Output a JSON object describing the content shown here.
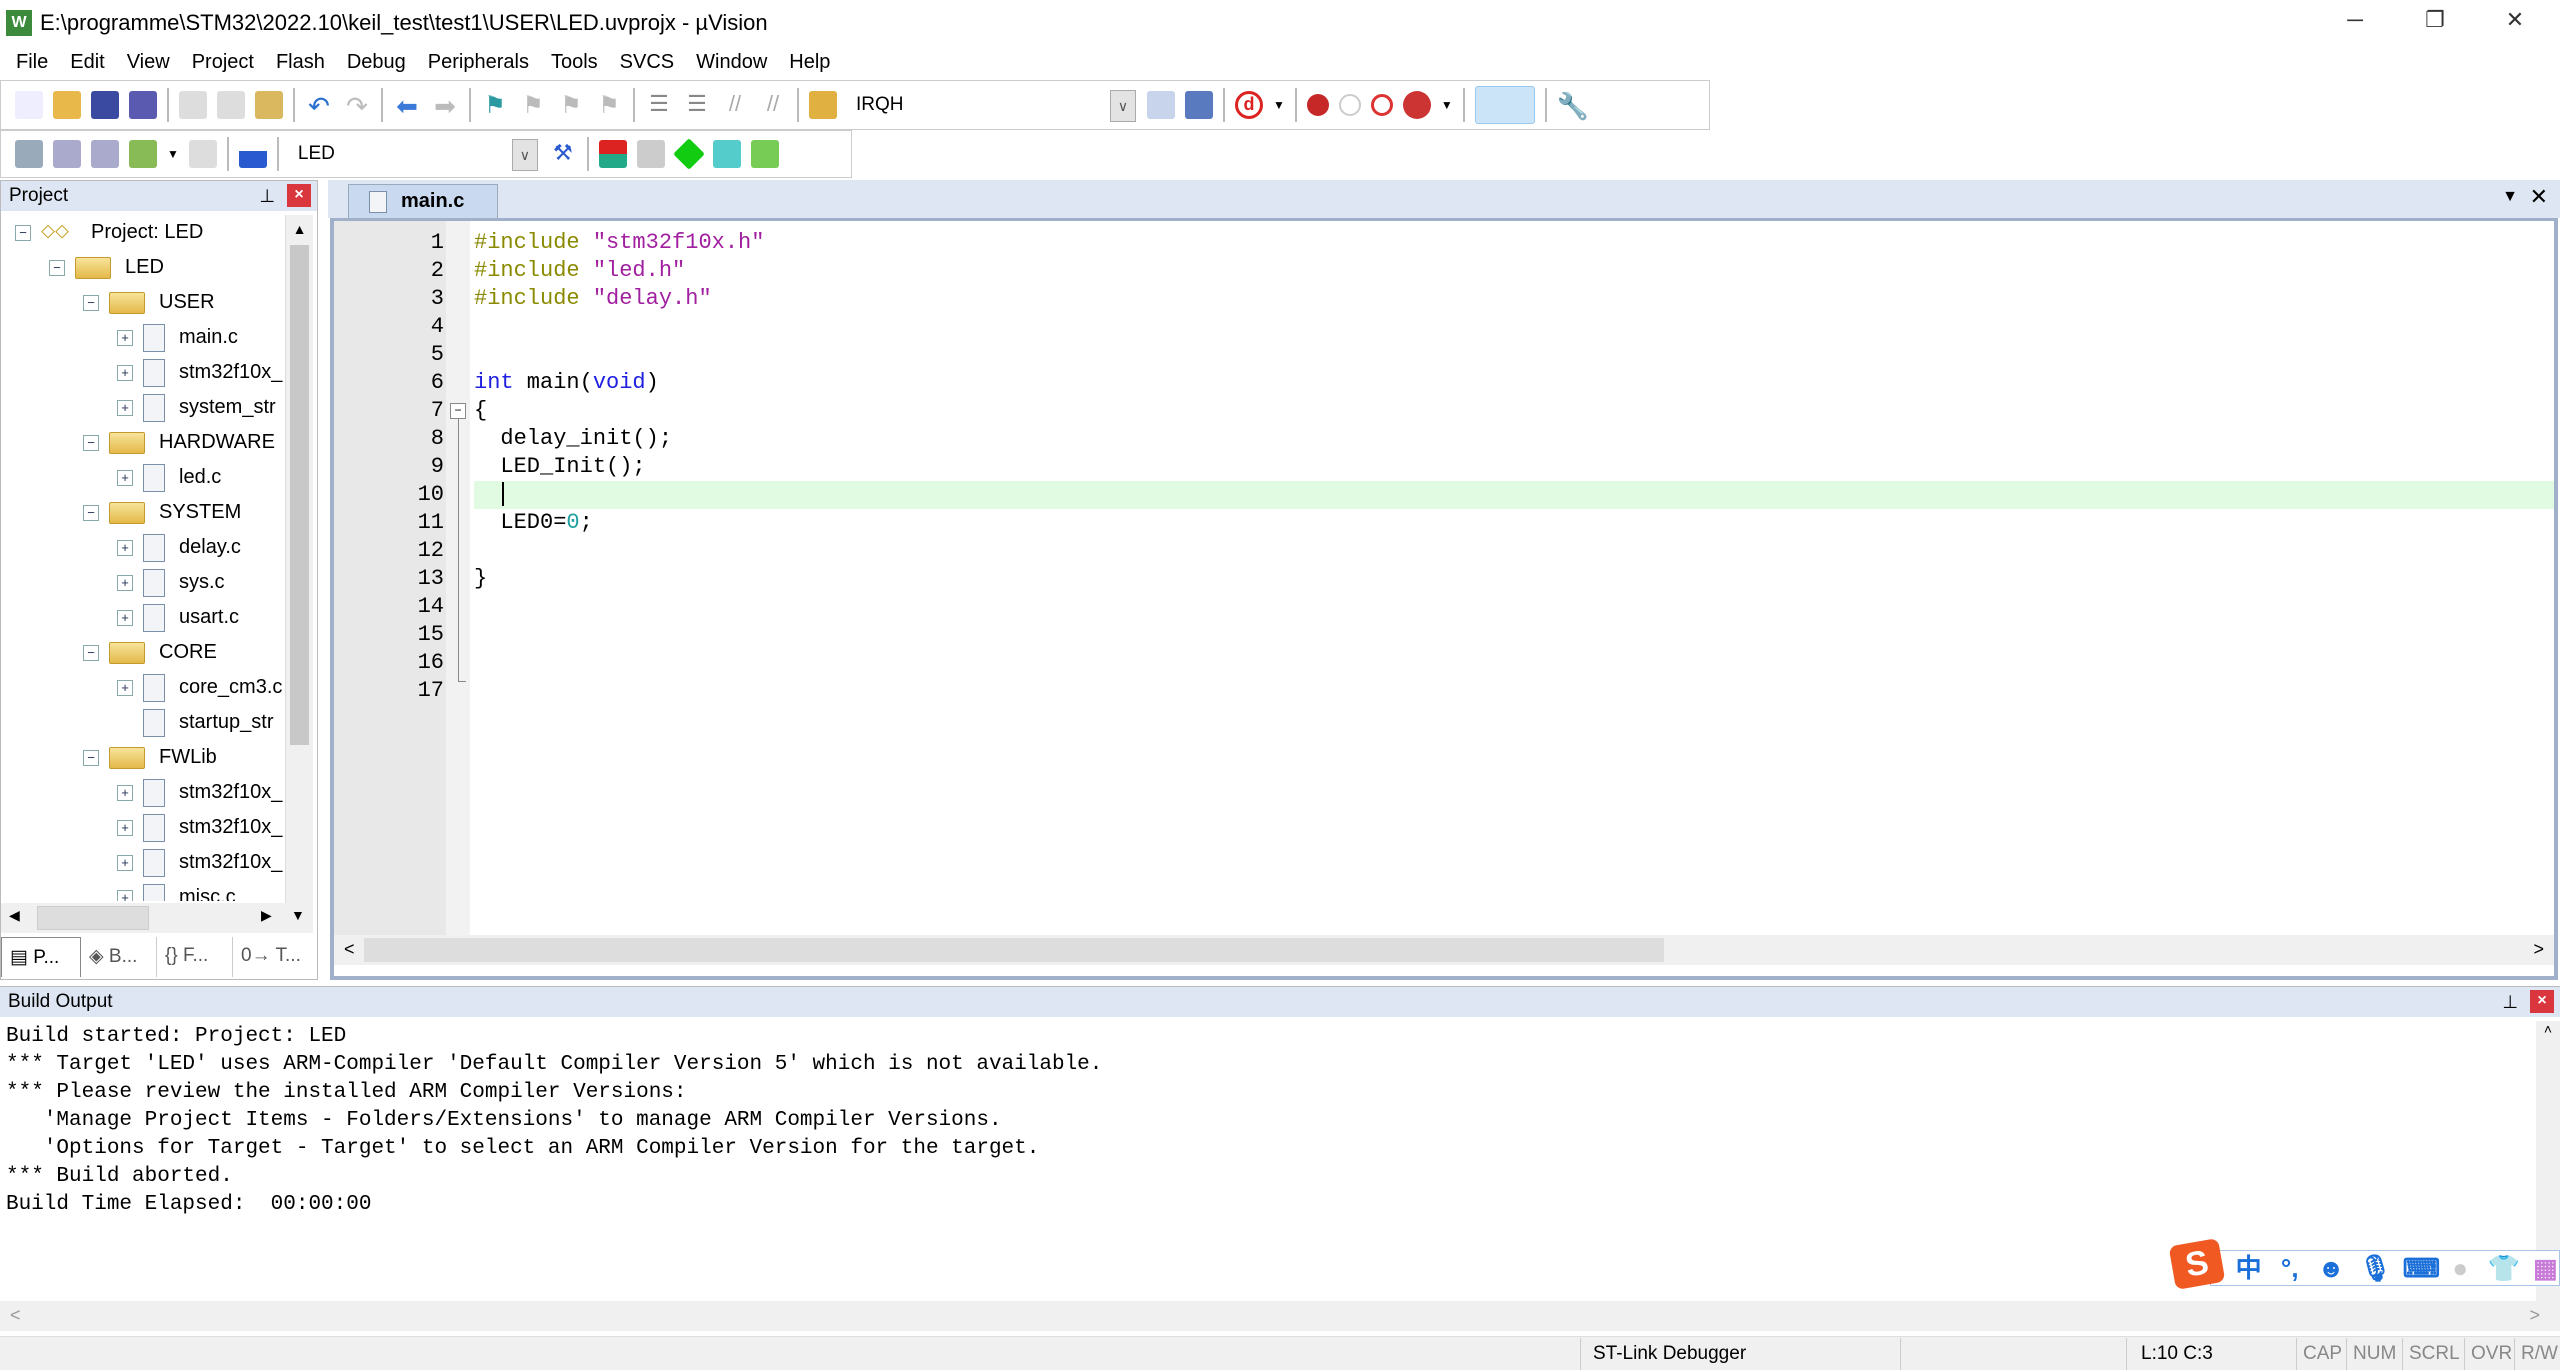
{
  "window": {
    "title": "E:\\programme\\STM32\\2022.10\\keil_test\\test1\\USER\\LED.uvprojx - µVision",
    "minimize": "─",
    "restore": "❐",
    "close": "✕"
  },
  "menu": [
    "File",
    "Edit",
    "View",
    "Project",
    "Flash",
    "Debug",
    "Peripherals",
    "Tools",
    "SVCS",
    "Window",
    "Help"
  ],
  "toolbar1": {
    "find_combo": "IRQH"
  },
  "toolbar2": {
    "target_combo": "LED"
  },
  "project_panel": {
    "title": "Project",
    "tree": [
      {
        "label": "Project: LED",
        "level": 0,
        "kind": "project",
        "exp": "−"
      },
      {
        "label": "LED",
        "level": 1,
        "kind": "target",
        "exp": "−"
      },
      {
        "label": "USER",
        "level": 2,
        "kind": "folder",
        "exp": "−"
      },
      {
        "label": "main.c",
        "level": 3,
        "kind": "file",
        "exp": "+"
      },
      {
        "label": "stm32f10x_",
        "level": 3,
        "kind": "file",
        "exp": "+"
      },
      {
        "label": "system_str",
        "level": 3,
        "kind": "file",
        "exp": "+"
      },
      {
        "label": "HARDWARE",
        "level": 2,
        "kind": "folder",
        "exp": "−"
      },
      {
        "label": "led.c",
        "level": 3,
        "kind": "file",
        "exp": "+"
      },
      {
        "label": "SYSTEM",
        "level": 2,
        "kind": "folder",
        "exp": "−"
      },
      {
        "label": "delay.c",
        "level": 3,
        "kind": "file",
        "exp": "+"
      },
      {
        "label": "sys.c",
        "level": 3,
        "kind": "file",
        "exp": "+"
      },
      {
        "label": "usart.c",
        "level": 3,
        "kind": "file",
        "exp": "+"
      },
      {
        "label": "CORE",
        "level": 2,
        "kind": "folder",
        "exp": "−"
      },
      {
        "label": "core_cm3.c",
        "level": 3,
        "kind": "file",
        "exp": "+"
      },
      {
        "label": "startup_str",
        "level": 3,
        "kind": "file",
        "exp": ""
      },
      {
        "label": "FWLib",
        "level": 2,
        "kind": "folder",
        "exp": "−"
      },
      {
        "label": "stm32f10x_",
        "level": 3,
        "kind": "file",
        "exp": "+"
      },
      {
        "label": "stm32f10x_",
        "level": 3,
        "kind": "file",
        "exp": "+"
      },
      {
        "label": "stm32f10x_",
        "level": 3,
        "kind": "file",
        "exp": "+"
      },
      {
        "label": "misc.c",
        "level": 3,
        "kind": "file",
        "exp": "+"
      }
    ],
    "tabs": [
      "P...",
      "B...",
      "F...",
      "T..."
    ]
  },
  "editor": {
    "tab": "main.c",
    "current_line": 10,
    "lines": [
      [
        {
          "t": "#include ",
          "c": "#8a8a00"
        },
        {
          "t": "\"stm32f10x.h\"",
          "c": "#a020a0"
        }
      ],
      [
        {
          "t": "#include ",
          "c": "#8a8a00"
        },
        {
          "t": "\"led.h\"",
          "c": "#a020a0"
        }
      ],
      [
        {
          "t": "#include ",
          "c": "#8a8a00"
        },
        {
          "t": "\"delay.h\"",
          "c": "#a020a0"
        }
      ],
      [],
      [],
      [
        {
          "t": "int",
          "c": "#2020e0"
        },
        {
          "t": " main",
          "c": "#000000"
        },
        {
          "t": "(",
          "c": "#000000"
        },
        {
          "t": "void",
          "c": "#2020e0"
        },
        {
          "t": ")",
          "c": "#000000"
        }
      ],
      [
        {
          "t": "{",
          "c": "#000000"
        }
      ],
      [
        {
          "t": "  delay_init();",
          "c": "#000000"
        }
      ],
      [
        {
          "t": "  LED_Init();",
          "c": "#000000"
        }
      ],
      [],
      [
        {
          "t": "  LED0=",
          "c": "#000000"
        },
        {
          "t": "0",
          "c": "#20a0a0"
        },
        {
          "t": ";",
          "c": "#000000"
        }
      ],
      [],
      [
        {
          "t": "}",
          "c": "#000000"
        }
      ],
      [],
      [],
      [],
      []
    ]
  },
  "build_output": {
    "title": "Build Output",
    "lines": [
      "Build started: Project: LED",
      "*** Target 'LED' uses ARM-Compiler 'Default Compiler Version 5' which is not available.",
      "*** Please review the installed ARM Compiler Versions:",
      "   'Manage Project Items - Folders/Extensions' to manage ARM Compiler Versions.",
      "   'Options for Target - Target' to select an ARM Compiler Version for the target.",
      "*** Build aborted.",
      "Build Time Elapsed:  00:00:00"
    ]
  },
  "ime": {
    "lang": "中",
    "punct": "°,"
  },
  "status": {
    "debugger": "ST-Link Debugger",
    "position": "L:10 C:3",
    "cap": "CAP",
    "num": "NUM",
    "scrl": "SCRL",
    "ovr": "OVR",
    "rw": "R/W"
  }
}
